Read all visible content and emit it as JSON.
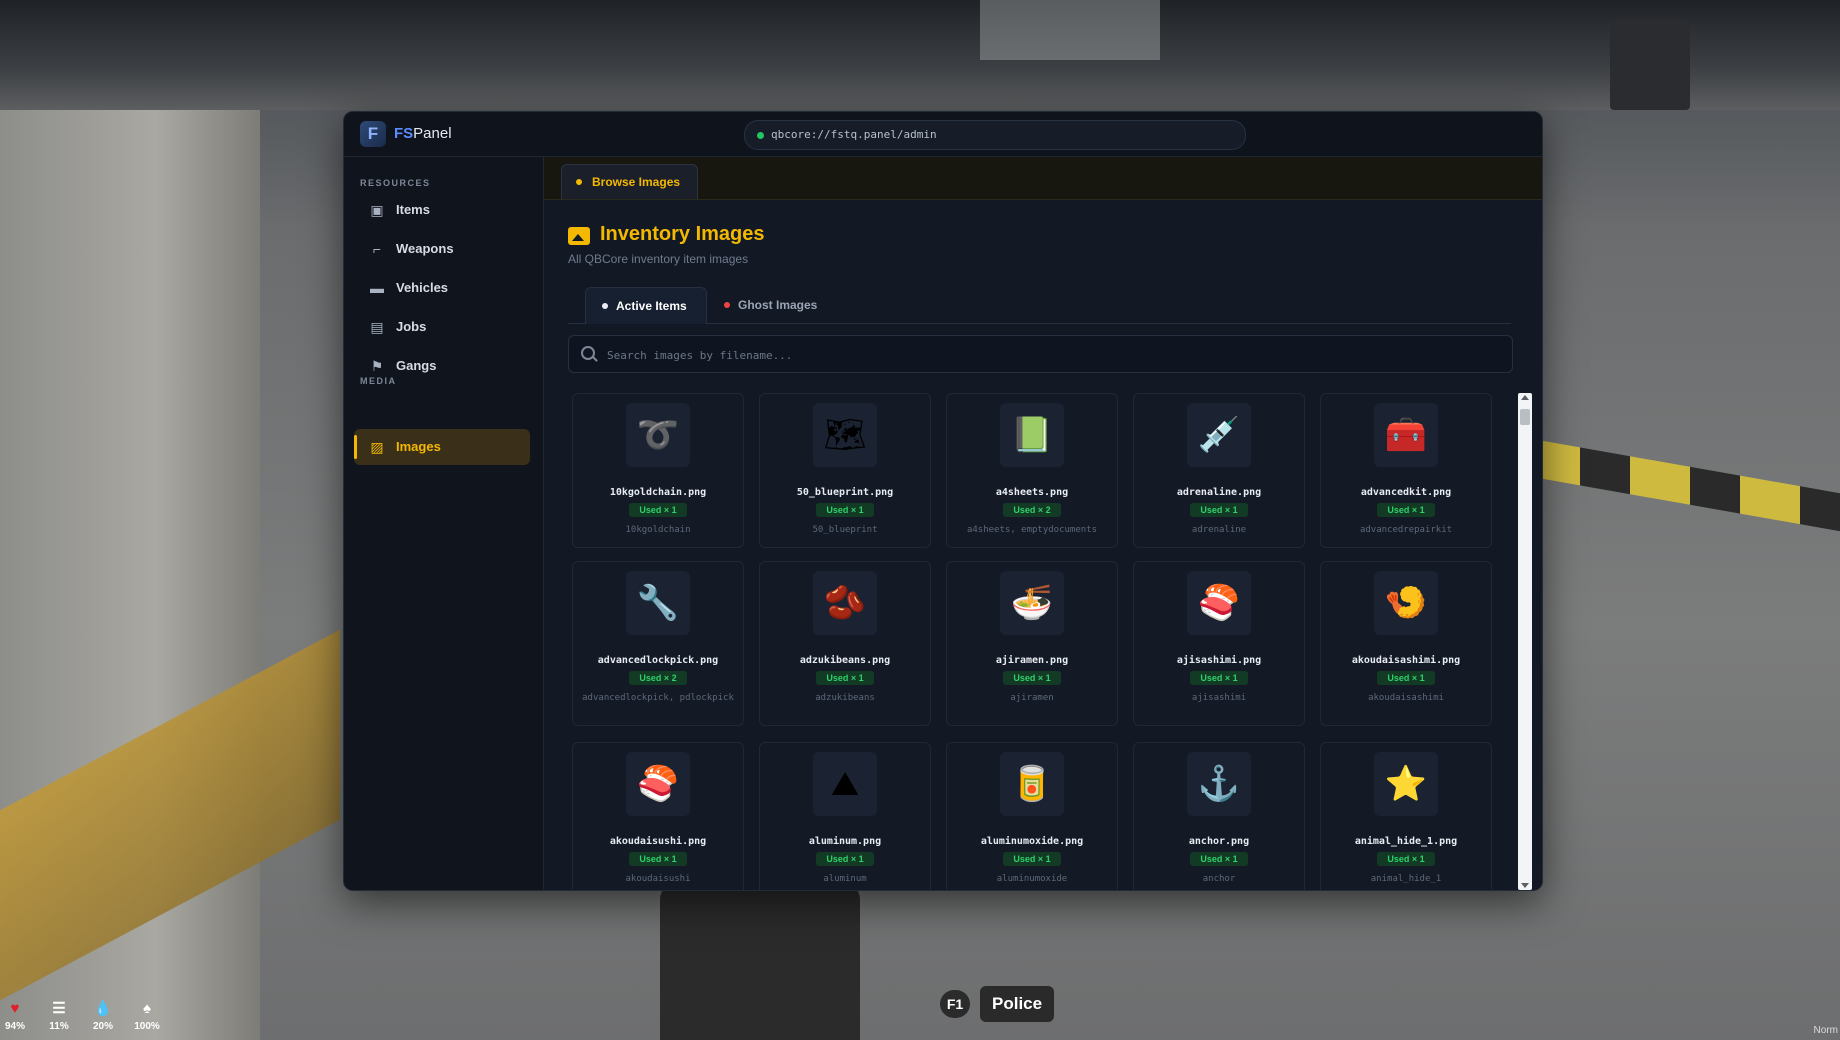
{
  "panel": {
    "logo_letter": "F",
    "brand_bold": "FS",
    "brand_rest": "Panel",
    "url": "qbcore://fstq.panel/admin"
  },
  "sidebar": {
    "resources_label": "RESOURCES",
    "media_label": "MEDIA",
    "items": [
      {
        "label": "Items",
        "icon": "box-icon"
      },
      {
        "label": "Weapons",
        "icon": "gun-icon"
      },
      {
        "label": "Vehicles",
        "icon": "car-icon"
      },
      {
        "label": "Jobs",
        "icon": "briefcase-icon"
      },
      {
        "label": "Gangs",
        "icon": "flag-icon"
      }
    ],
    "media_items": [
      {
        "label": "Images",
        "icon": "image-icon",
        "active": true
      }
    ]
  },
  "content": {
    "top_tab": "Browse Images",
    "title": "Inventory Images",
    "subtitle": "All QBCore inventory item images",
    "tabs": [
      {
        "label": "Active Items",
        "active": true
      },
      {
        "label": "Ghost Images",
        "active": false
      }
    ],
    "search_placeholder": "Search images by filename..."
  },
  "images": [
    {
      "file": "10kgoldchain.png",
      "used": "Used × 1",
      "items": "10kgoldchain",
      "glyph": "➰"
    },
    {
      "file": "50_blueprint.png",
      "used": "Used × 1",
      "items": "50_blueprint",
      "glyph": "🗺"
    },
    {
      "file": "a4sheets.png",
      "used": "Used × 2",
      "items": "a4sheets, emptydocuments",
      "glyph": "📗"
    },
    {
      "file": "adrenaline.png",
      "used": "Used × 1",
      "items": "adrenaline",
      "glyph": "💉"
    },
    {
      "file": "advancedkit.png",
      "used": "Used × 1",
      "items": "advancedrepairkit",
      "glyph": "🧰"
    },
    {
      "file": "advancedlockpick.png",
      "used": "Used × 2",
      "items": "advancedlockpick, pdlockpick",
      "glyph": "🔧"
    },
    {
      "file": "adzukibeans.png",
      "used": "Used × 1",
      "items": "adzukibeans",
      "glyph": "🫘"
    },
    {
      "file": "ajiramen.png",
      "used": "Used × 1",
      "items": "ajiramen",
      "glyph": "🍜"
    },
    {
      "file": "ajisashimi.png",
      "used": "Used × 1",
      "items": "ajisashimi",
      "glyph": "🍣"
    },
    {
      "file": "akoudaisashimi.png",
      "used": "Used × 1",
      "items": "akoudaisashimi",
      "glyph": "🍤"
    },
    {
      "file": "akoudaisushi.png",
      "used": "Used × 1",
      "items": "akoudaisushi",
      "glyph": "🍣"
    },
    {
      "file": "aluminum.png",
      "used": "Used × 1",
      "items": "aluminum",
      "glyph": "⛰"
    },
    {
      "file": "aluminumoxide.png",
      "used": "Used × 1",
      "items": "aluminumoxide",
      "glyph": "🥫"
    },
    {
      "file": "anchor.png",
      "used": "Used × 1",
      "items": "anchor",
      "glyph": "⚓"
    },
    {
      "file": "animal_hide_1.png",
      "used": "Used × 1",
      "items": "animal_hide_1",
      "glyph": "⭐"
    }
  ],
  "hud": [
    {
      "value": "94%",
      "icon": "heart-icon",
      "glyph": "♥",
      "color": "#e11d2a"
    },
    {
      "value": "11%",
      "icon": "burger-icon",
      "glyph": "☰",
      "color": "#ffffff"
    },
    {
      "value": "20%",
      "icon": "water-drop-icon",
      "glyph": "💧",
      "color": "#ffffff"
    },
    {
      "value": "100%",
      "icon": "lungs-icon",
      "glyph": "♠",
      "color": "#ffffff"
    }
  ],
  "job": {
    "key": "F1",
    "name": "Police"
  },
  "corner": "Norm",
  "colors": {
    "accent": "#f5b800",
    "panel_bg": "#111722",
    "used_green": "#2fd16a",
    "ghost_red": "#ef4444"
  }
}
